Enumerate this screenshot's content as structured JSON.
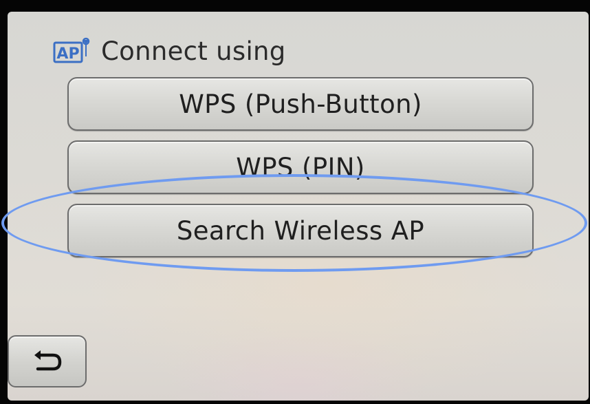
{
  "header": {
    "icon": "ap-settings-icon",
    "icon_text": "AP",
    "title": "Connect using"
  },
  "options": [
    {
      "label": "WPS (Push-Button)"
    },
    {
      "label": "WPS (PIN)"
    },
    {
      "label": "Search Wireless AP"
    }
  ],
  "highlighted_option": "Search Wireless AP",
  "back_button": {
    "icon": "back-arrow-icon"
  },
  "colors": {
    "highlight_ring": "#6f9bf0",
    "ap_icon": "#3b6fc4",
    "text": "#1f1f1f"
  }
}
